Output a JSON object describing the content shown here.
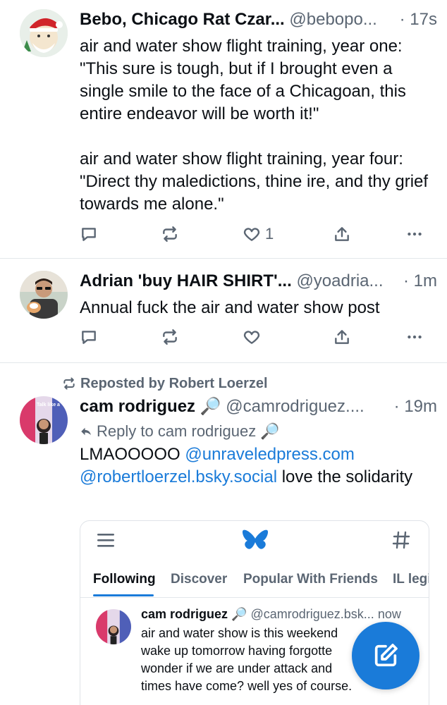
{
  "posts": [
    {
      "name": "Bebo, Chicago Rat Czar...",
      "handle": "@bebopo...",
      "sep": "·",
      "time": "17s",
      "text": "air and water show flight training, year one: \"This sure is tough, but if I brought even a single smile to the face of a Chicagoan, this entire endeavor will be worth it!\"\n\nair and water show flight training, year four: \"Direct thy maledictions, thine ire, and thy grief towards me alone.\"",
      "like_count": "1"
    },
    {
      "name": "Adrian 'buy HAIR SHIRT'...",
      "handle": "@yoadria...",
      "sep": "·",
      "time": "1m",
      "text": "Annual fuck the air and water show post",
      "like_count": ""
    },
    {
      "repost_label": "Reposted by Robert Loerzel",
      "name": "cam rodriguez 🔎",
      "handle": "@camrodriguez....",
      "sep": "·",
      "time": "19m",
      "reply_label": "Reply to cam rodriguez 🔎",
      "text_plain_1": "LMAOOOOO ",
      "link_1": "@unraveledpress.com",
      "link_2": "@robertloerzel.bsky.social",
      "text_plain_2": " love the solidarity"
    }
  ],
  "embed": {
    "tabs": [
      "Following",
      "Discover",
      "Popular With Friends",
      "IL legi"
    ],
    "active_tab": "Following",
    "inner_post": {
      "name": "cam rodriguez 🔎",
      "handle": "@camrodriguez.bsk...",
      "time": "now",
      "text": "air and water show is this weekend\nwake up tomorrow having forgotte\nwonder if we are under attack and\ntimes have come? well yes of course."
    }
  },
  "colors": {
    "accent": "#1a7bd9",
    "muted": "#5b6673",
    "divider": "#e3e7eb"
  },
  "icons": [
    "reply-icon",
    "repost-icon",
    "heart-icon",
    "share-icon",
    "more-icon",
    "menu-icon",
    "butterfly-icon",
    "hashtag-icon",
    "compose-icon"
  ]
}
